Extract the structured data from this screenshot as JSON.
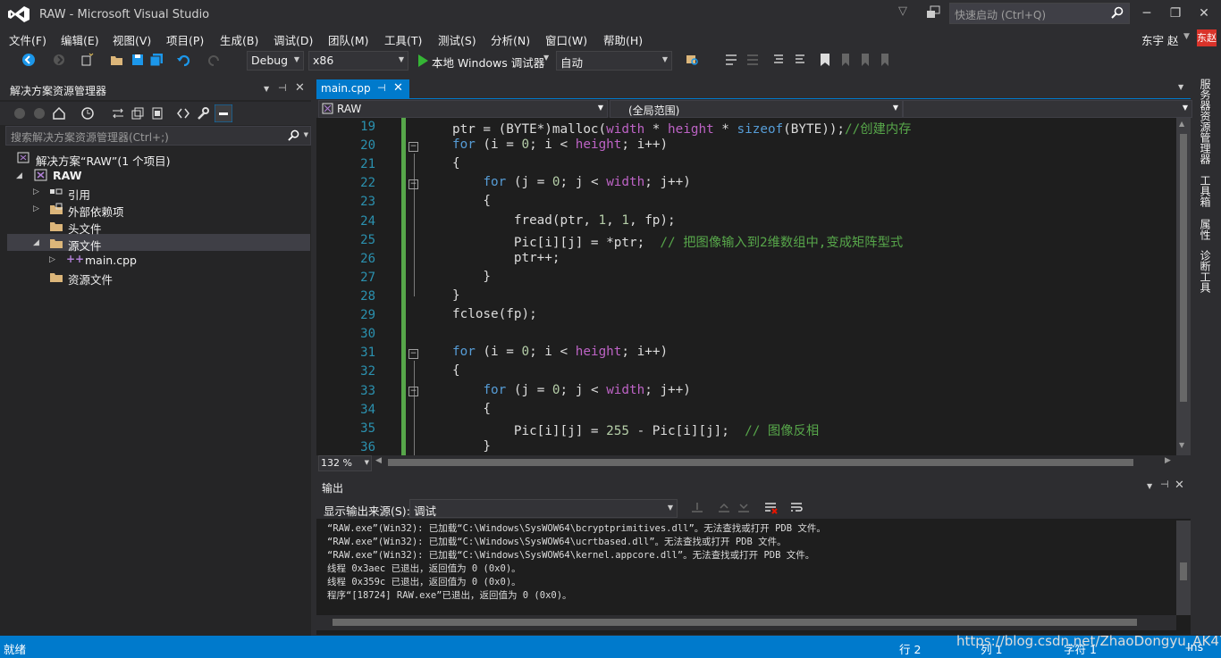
{
  "app": {
    "title": "RAW - Microsoft Visual Studio",
    "quicklaunch_placeholder": "快速启动 (Ctrl+Q)",
    "user_name": "东宇 赵",
    "user_badge": "东赵"
  },
  "menu": [
    "文件(F)",
    "编辑(E)",
    "视图(V)",
    "项目(P)",
    "生成(B)",
    "调试(D)",
    "团队(M)",
    "工具(T)",
    "测试(S)",
    "分析(N)",
    "窗口(W)",
    "帮助(H)"
  ],
  "toolbar": {
    "config": "Debug",
    "platform": "x86",
    "run_label": "本地 Windows 调试器",
    "run_mode": "自动"
  },
  "solution_explorer": {
    "title": "解决方案资源管理器",
    "search_placeholder": "搜索解决方案资源管理器(Ctrl+;)",
    "solution": "解决方案“RAW”(1 个项目)",
    "project": "RAW",
    "items": [
      {
        "label": "引用"
      },
      {
        "label": "外部依赖项"
      },
      {
        "label": "头文件"
      },
      {
        "label": "源文件"
      },
      {
        "label": "main.cpp"
      },
      {
        "label": "资源文件"
      }
    ]
  },
  "editor": {
    "tab": "main.cpp",
    "nav_file": "RAW",
    "nav_scope": "(全局范围)",
    "zoom": "132 %",
    "line_numbers": [
      "19",
      "20",
      "21",
      "22",
      "23",
      "24",
      "25",
      "26",
      "27",
      "28",
      "29",
      "30",
      "31",
      "32",
      "33",
      "34",
      "35",
      "36"
    ]
  },
  "right_tabs": [
    "服务器资源管理器",
    "工具箱",
    "属性",
    "诊断工具"
  ],
  "output": {
    "title": "输出",
    "source_label": "显示输出来源(S):",
    "source_value": "调试",
    "lines": [
      "“RAW.exe”(Win32): 已加载“C:\\Windows\\SysWOW64\\bcryptprimitives.dll”。无法查找或打开 PDB 文件。",
      "“RAW.exe”(Win32): 已加载“C:\\Windows\\SysWOW64\\ucrtbased.dll”。无法查找或打开 PDB 文件。",
      "“RAW.exe”(Win32): 已加载“C:\\Windows\\SysWOW64\\kernel.appcore.dll”。无法查找或打开 PDB 文件。",
      "线程 0x3aec 已退出，返回值为 0 (0x0)。",
      "线程 0x359c 已退出，返回值为 0 (0x0)。",
      "程序“[18724] RAW.exe”已退出，返回值为 0 (0x0)。"
    ]
  },
  "status": {
    "text": "就绪",
    "row": "行 2",
    "col": "列 1",
    "char": "字符 1",
    "ins": "Ins",
    "watermark": "https://blog.csdn.net/ZhaoDongyu_AK47"
  }
}
